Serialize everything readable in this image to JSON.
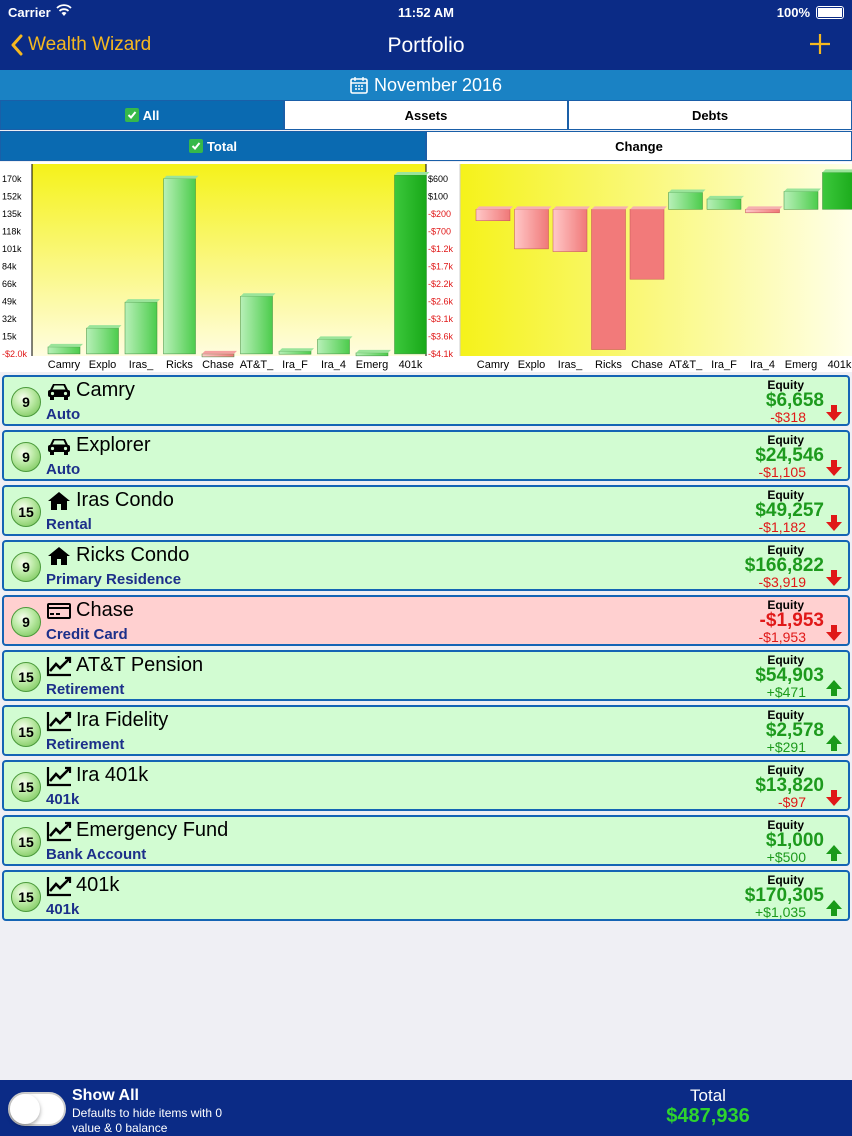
{
  "status": {
    "carrier": "Carrier",
    "time": "11:52 AM",
    "battery": "100%"
  },
  "nav": {
    "back_label": "Wealth Wizard",
    "title": "Portfolio"
  },
  "month": "November 2016",
  "filter_tabs": [
    {
      "label": "All",
      "selected": true
    },
    {
      "label": "Assets",
      "selected": false
    },
    {
      "label": "Debts",
      "selected": false
    }
  ],
  "mode_tabs": [
    {
      "label": "Total",
      "selected": true
    },
    {
      "label": "Change",
      "selected": false
    }
  ],
  "chart_data": [
    {
      "type": "bar",
      "categories": [
        "Camry",
        "Explo",
        "Iras_",
        "Ricks",
        "Chase",
        "AT&T_",
        "Ira_F",
        "Ira_4",
        "Emerg",
        "401k"
      ],
      "values": [
        6658,
        24546,
        49257,
        166822,
        -1953,
        54903,
        2578,
        13820,
        1000,
        170305
      ],
      "y_ticks_left": [
        "170k",
        "152k",
        "135k",
        "118k",
        "101k",
        "84k",
        "66k",
        "49k",
        "32k",
        "15k",
        "-$2.0k"
      ],
      "y_ticks_right": [
        "$600",
        "$100",
        "-$200",
        "-$700",
        "-$1.2k",
        "-$1.7k",
        "-$2.2k",
        "-$2.6k",
        "-$3.1k",
        "-$3.6k",
        "-$4.1k"
      ],
      "ylim": [
        -2000,
        177000
      ],
      "colors": {
        "positive": "#57d657",
        "negative": "#e05a5a",
        "background_top": "#f7f520",
        "background_bottom": "#ffffd8"
      }
    },
    {
      "type": "bar",
      "categories": [
        "Camry",
        "Explo",
        "Iras_",
        "Ricks",
        "Chase",
        "AT&T_",
        "Ira_F",
        "Ira_4",
        "Emerg",
        "401k"
      ],
      "values": [
        -318,
        -1105,
        -1182,
        -3919,
        -1953,
        471,
        291,
        -97,
        500,
        1035
      ],
      "ylim": [
        -4100,
        1100
      ],
      "colors": {
        "positive": "#57d657",
        "negative": "#f28a8a"
      }
    }
  ],
  "accounts": [
    {
      "badge": "9",
      "icon": "car-icon",
      "name": "Camry",
      "category": "Auto",
      "equity_label": "Equity",
      "balance": "$6,658",
      "change": "-$318",
      "trend": "down",
      "negative": false
    },
    {
      "badge": "9",
      "icon": "car-icon",
      "name": "Explorer",
      "category": "Auto",
      "equity_label": "Equity",
      "balance": "$24,546",
      "change": "-$1,105",
      "trend": "down",
      "negative": false
    },
    {
      "badge": "15",
      "icon": "home-icon",
      "name": "Iras Condo",
      "category": "Rental",
      "equity_label": "Equity",
      "balance": "$49,257",
      "change": "-$1,182",
      "trend": "down",
      "negative": false
    },
    {
      "badge": "9",
      "icon": "home-icon",
      "name": "Ricks Condo",
      "category": "Primary Residence",
      "equity_label": "Equity",
      "balance": "$166,822",
      "change": "-$3,919",
      "trend": "down",
      "negative": false
    },
    {
      "badge": "9",
      "icon": "credit-card-icon",
      "name": "Chase",
      "category": "Credit Card",
      "equity_label": "Equity",
      "balance": "-$1,953",
      "change": "-$1,953",
      "trend": "down",
      "negative": true
    },
    {
      "badge": "15",
      "icon": "line-chart-icon",
      "name": "AT&T Pension",
      "category": "Retirement",
      "equity_label": "Equity",
      "balance": "$54,903",
      "change": "+$471",
      "trend": "up",
      "negative": false
    },
    {
      "badge": "15",
      "icon": "line-chart-icon",
      "name": "Ira Fidelity",
      "category": "Retirement",
      "equity_label": "Equity",
      "balance": "$2,578",
      "change": "+$291",
      "trend": "up",
      "negative": false
    },
    {
      "badge": "15",
      "icon": "line-chart-icon",
      "name": "Ira 401k",
      "category": "401k",
      "equity_label": "Equity",
      "balance": "$13,820",
      "change": "-$97",
      "trend": "down",
      "negative": false
    },
    {
      "badge": "15",
      "icon": "line-chart-icon",
      "name": "Emergency Fund",
      "category": "Bank Account",
      "equity_label": "Equity",
      "balance": "$1,000",
      "change": "+$500",
      "trend": "up",
      "negative": false
    },
    {
      "badge": "15",
      "icon": "line-chart-icon",
      "name": "401k",
      "category": "401k",
      "equity_label": "Equity",
      "balance": "$170,305",
      "change": "+$1,035",
      "trend": "up",
      "negative": false
    }
  ],
  "footer": {
    "show_all_label": "Show All",
    "show_all_hint": "Defaults to hide items with 0 value & 0 balance",
    "show_all_on": false,
    "total_label": "Total",
    "total_value": "$487,936"
  },
  "colors": {
    "nav": "#0b2b86",
    "accent": "#f5b820",
    "month_bar": "#1a82c4",
    "row_bg": "#d2fcd2",
    "row_neg_bg": "#ffd0d0"
  }
}
